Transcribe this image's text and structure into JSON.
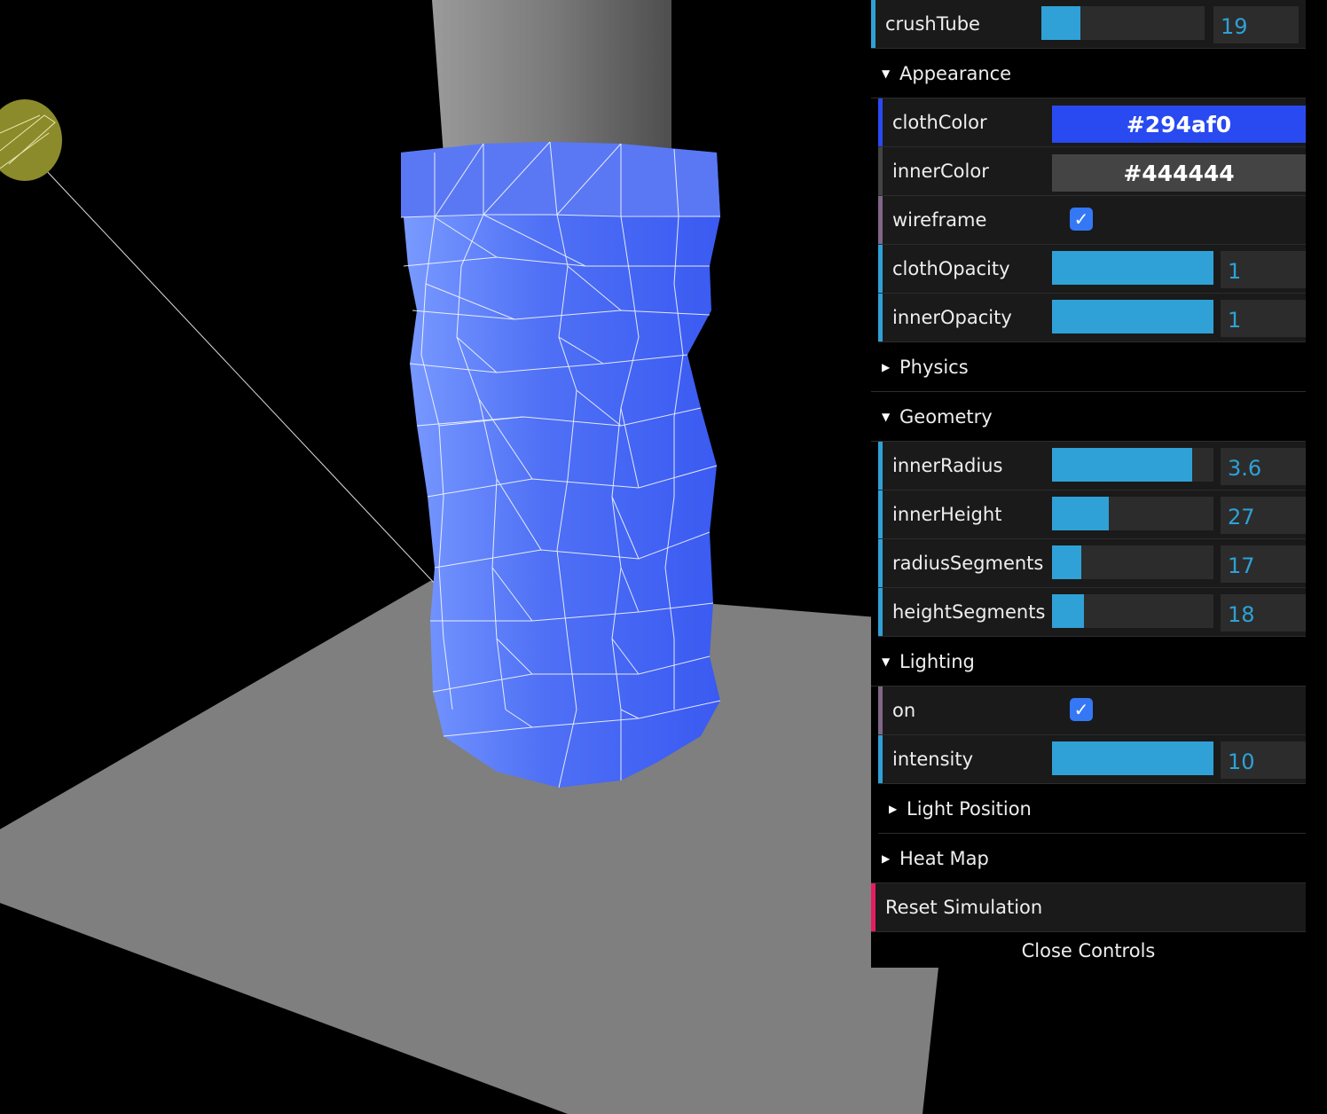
{
  "scene": {
    "background": "#000000",
    "cloth_color": "#294af0",
    "column_color": "#7a7a7a",
    "floor_color": "#808080",
    "light_helper_color": "#8b8b2b"
  },
  "controls": {
    "crushTube": {
      "label": "crushTube",
      "value": "19",
      "fill_fraction": 0.24,
      "stripe": "#2fa1d6"
    },
    "appearance": {
      "title": "Appearance",
      "expanded": true,
      "clothColor": {
        "label": "clothColor",
        "value": "#294af0",
        "swatch": "#294af0",
        "stripe": "#294af0"
      },
      "innerColor": {
        "label": "innerColor",
        "value": "#444444",
        "swatch": "#444444",
        "stripe": "#444444"
      },
      "wireframe": {
        "label": "wireframe",
        "checked": true,
        "stripe": "#806787"
      },
      "clothOpacity": {
        "label": "clothOpacity",
        "value": "1",
        "fill_fraction": 1.0,
        "stripe": "#2fa1d6"
      },
      "innerOpacity": {
        "label": "innerOpacity",
        "value": "1",
        "fill_fraction": 1.0,
        "stripe": "#2fa1d6"
      }
    },
    "physics": {
      "title": "Physics",
      "expanded": false
    },
    "geometry": {
      "title": "Geometry",
      "expanded": true,
      "innerRadius": {
        "label": "innerRadius",
        "value": "3.6",
        "fill_fraction": 0.87,
        "stripe": "#2fa1d6"
      },
      "innerHeight": {
        "label": "innerHeight",
        "value": "27",
        "fill_fraction": 0.35,
        "stripe": "#2fa1d6"
      },
      "radiusSegments": {
        "label": "radiusSegments",
        "value": "17",
        "fill_fraction": 0.18,
        "stripe": "#2fa1d6"
      },
      "heightSegments": {
        "label": "heightSegments",
        "value": "18",
        "fill_fraction": 0.2,
        "stripe": "#2fa1d6"
      }
    },
    "lighting": {
      "title": "Lighting",
      "expanded": true,
      "on": {
        "label": "on",
        "checked": true,
        "stripe": "#806787"
      },
      "intensity": {
        "label": "intensity",
        "value": "10",
        "fill_fraction": 1.0,
        "stripe": "#2fa1d6"
      },
      "lightPosition": {
        "title": "Light Position",
        "expanded": false
      }
    },
    "heatMap": {
      "title": "Heat Map",
      "expanded": false
    },
    "reset": {
      "label": "Reset Simulation",
      "stripe": "#e61d5f"
    },
    "close_label": "Close Controls"
  }
}
